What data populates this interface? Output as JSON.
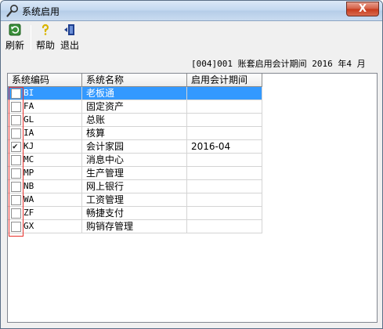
{
  "window": {
    "title": "系统启用",
    "close_label": "X"
  },
  "toolbar": {
    "refresh_label": "刷新",
    "help_label": "帮助",
    "exit_label": "退出"
  },
  "period_text": "[004]001 账套启用会计期间 2016 年4 月",
  "table": {
    "columns": [
      "系统编码",
      "系统名称",
      "启用会计期间"
    ],
    "rows": [
      {
        "code": "BI",
        "name": "老板通",
        "period": "",
        "enabled": false,
        "selected": true
      },
      {
        "code": "FA",
        "name": "固定资产",
        "period": "",
        "enabled": false,
        "selected": false
      },
      {
        "code": "GL",
        "name": "总账",
        "period": "",
        "enabled": false,
        "selected": false
      },
      {
        "code": "IA",
        "name": "核算",
        "period": "",
        "enabled": false,
        "selected": false
      },
      {
        "code": "KJ",
        "name": "会计家园",
        "period": "2016-04",
        "enabled": true,
        "selected": false
      },
      {
        "code": "MC",
        "name": "消息中心",
        "period": "",
        "enabled": false,
        "selected": false
      },
      {
        "code": "MP",
        "name": "生产管理",
        "period": "",
        "enabled": false,
        "selected": false
      },
      {
        "code": "NB",
        "name": "网上银行",
        "period": "",
        "enabled": false,
        "selected": false
      },
      {
        "code": "WA",
        "name": "工资管理",
        "period": "",
        "enabled": false,
        "selected": false
      },
      {
        "code": "ZF",
        "name": "畅捷支付",
        "period": "",
        "enabled": false,
        "selected": false
      },
      {
        "code": "GX",
        "name": "购销存管理",
        "period": "",
        "enabled": false,
        "selected": false
      }
    ]
  },
  "colors": {
    "selection": "#3399ff",
    "highlight_border": "#e8302b"
  }
}
